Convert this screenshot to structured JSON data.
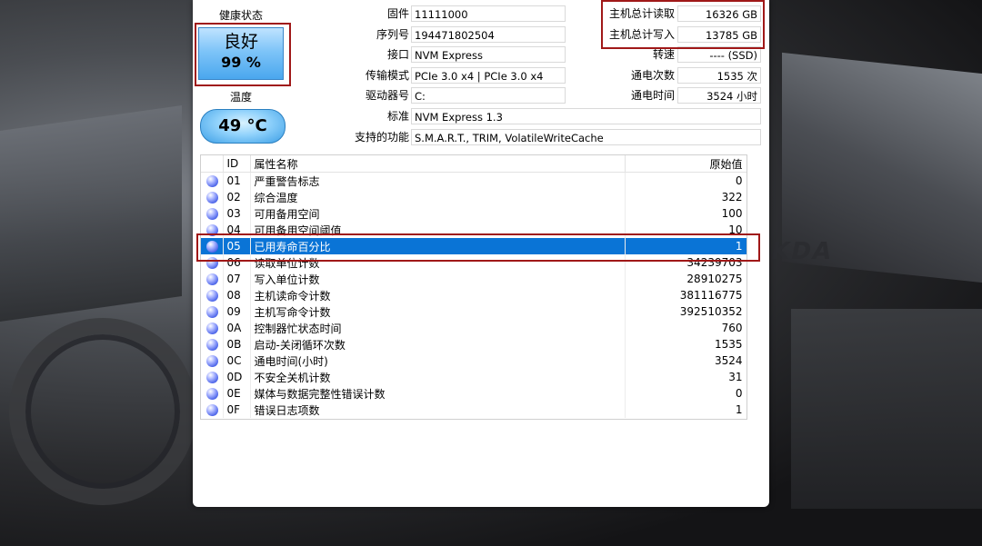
{
  "background": {
    "text": "KDA"
  },
  "left": {
    "health_label": "健康状态",
    "health_status": "良好",
    "health_percent": "99 %",
    "temp_label": "温度",
    "temp_value": "49 °C"
  },
  "info": {
    "firmware_label": "固件",
    "firmware": "11111000",
    "serial_label": "序列号",
    "serial": "194471802504",
    "interface_label": "接口",
    "interface": "NVM Express",
    "transfer_label": "传输模式",
    "transfer": "PCIe 3.0 x4 | PCIe 3.0 x4",
    "drive_label": "驱动器号",
    "drive": "C:",
    "standard_label": "标准",
    "standard": "NVM Express 1.3",
    "features_label": "支持的功能",
    "features": "S.M.A.R.T., TRIM, VolatileWriteCache"
  },
  "stats": {
    "host_reads_label": "主机总计读取",
    "host_reads": "16326 GB",
    "host_writes_label": "主机总计写入",
    "host_writes": "13785 GB",
    "rpm_label": "转速",
    "rpm": "---- (SSD)",
    "power_count_label": "通电次数",
    "power_count": "1535 次",
    "power_hours_label": "通电时间",
    "power_hours": "3524 小时"
  },
  "table": {
    "headers": {
      "id": "ID",
      "name": "属性名称",
      "raw": "原始值"
    },
    "rows": [
      {
        "id": "01",
        "name": "严重警告标志",
        "raw": "0"
      },
      {
        "id": "02",
        "name": "综合温度",
        "raw": "322"
      },
      {
        "id": "03",
        "name": "可用备用空间",
        "raw": "100"
      },
      {
        "id": "04",
        "name": "可用备用空间阈值",
        "raw": "10"
      },
      {
        "id": "05",
        "name": "已用寿命百分比",
        "raw": "1"
      },
      {
        "id": "06",
        "name": "读取单位计数",
        "raw": "34239703"
      },
      {
        "id": "07",
        "name": "写入单位计数",
        "raw": "28910275"
      },
      {
        "id": "08",
        "name": "主机读命令计数",
        "raw": "381116775"
      },
      {
        "id": "09",
        "name": "主机写命令计数",
        "raw": "392510352"
      },
      {
        "id": "0A",
        "name": "控制器忙状态时间",
        "raw": "760"
      },
      {
        "id": "0B",
        "name": "启动-关闭循环次数",
        "raw": "1535"
      },
      {
        "id": "0C",
        "name": "通电时间(小时)",
        "raw": "3524"
      },
      {
        "id": "0D",
        "name": "不安全关机计数",
        "raw": "31"
      },
      {
        "id": "0E",
        "name": "媒体与数据完整性错误计数",
        "raw": "0"
      },
      {
        "id": "0F",
        "name": "错误日志项数",
        "raw": "1"
      }
    ],
    "selected_index": 4
  },
  "colors": {
    "selection": "#0a74d6",
    "highlight_frame": "#a01818",
    "health_blue": "#4aa7ee"
  }
}
